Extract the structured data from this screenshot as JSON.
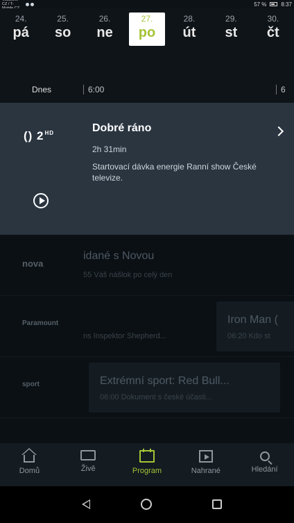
{
  "status": {
    "carrier": "Vodafone CZ / T-Mobile CZ",
    "battery": "57 %",
    "time": "8:37"
  },
  "days": [
    {
      "num": "24.",
      "name": "pá"
    },
    {
      "num": "25.",
      "name": "so"
    },
    {
      "num": "26.",
      "name": "ne"
    },
    {
      "num": "27.",
      "name": "po"
    },
    {
      "num": "28.",
      "name": "út"
    },
    {
      "num": "29.",
      "name": "st"
    },
    {
      "num": "30.",
      "name": "čt"
    }
  ],
  "timeline": {
    "today": "Dnes",
    "time1": "6:00",
    "time2": "6"
  },
  "featured": {
    "channel": "2",
    "channel_hd": "HD",
    "title": "Dobré ráno",
    "duration": "2h 31min",
    "description": "Startovací dávka energie Ranní show České televize."
  },
  "list": [
    {
      "logo": "nova",
      "title": "idané s Novou",
      "sub": "55 Váš nášlok po celý den"
    },
    {
      "logo": "Paramount",
      "title2": "Iron Man (",
      "sub": "ns Inspektor Shepherd...",
      "sub2": "06:20 Kdo st"
    },
    {
      "logo": "sport",
      "title": "Extrémní sport: Red Bull...",
      "sub": "06:00 Dokument s české účasti..."
    }
  ],
  "nav": [
    {
      "label": "Domů",
      "icon": "home-icon"
    },
    {
      "label": "Živě",
      "icon": "tv-icon"
    },
    {
      "label": "Program",
      "icon": "calendar-icon"
    },
    {
      "label": "Nahrané",
      "icon": "film-icon"
    },
    {
      "label": "Hledání",
      "icon": "search-icon"
    }
  ],
  "colors": {
    "accent": "#a5c437",
    "featured_bg": "#2a3540",
    "background": "#0f1418"
  }
}
